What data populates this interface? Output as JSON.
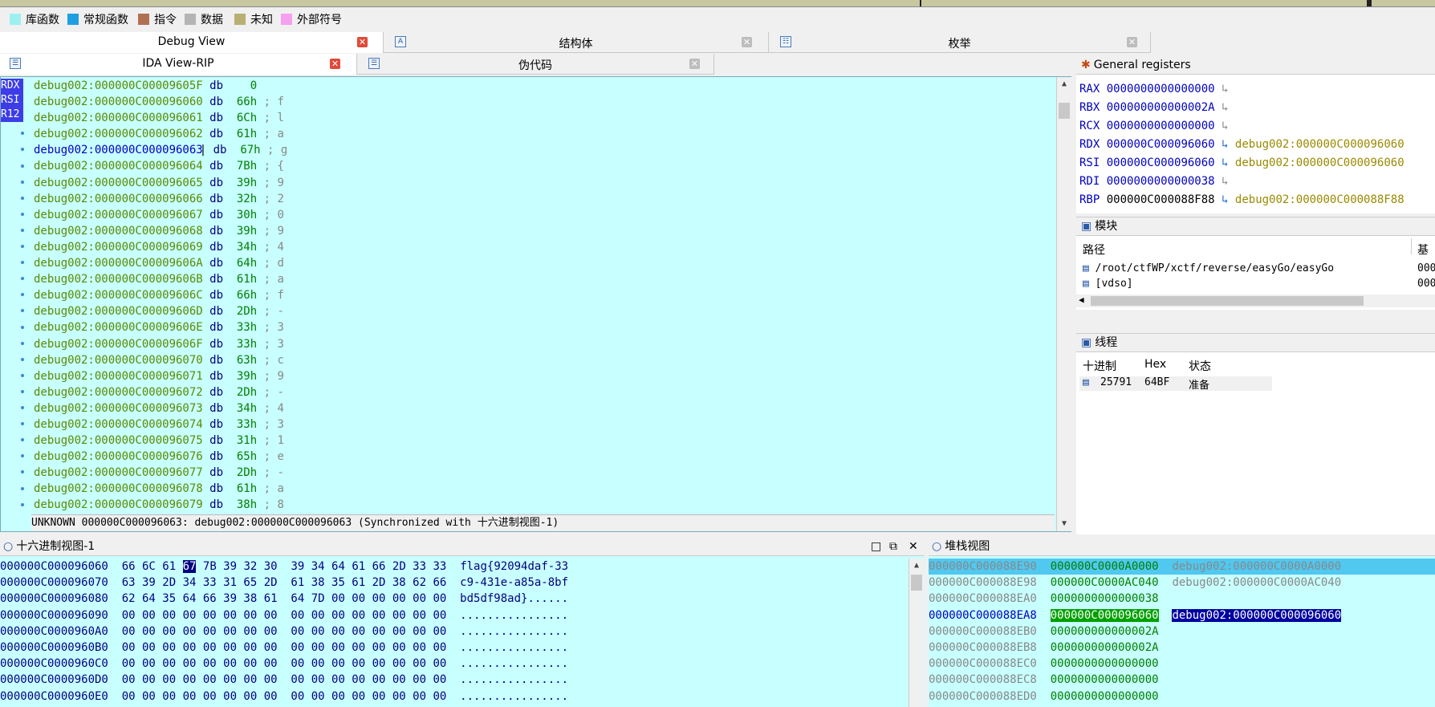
{
  "legend": [
    {
      "label": "库函数",
      "color": "#9ef0f0"
    },
    {
      "label": "常规函数",
      "color": "#1ea0e0"
    },
    {
      "label": "指令",
      "color": "#b07050"
    },
    {
      "label": "数据",
      "color": "#b4b4b4"
    },
    {
      "label": "未知",
      "color": "#b8b070"
    },
    {
      "label": "外部符号",
      "color": "#f8a0f0"
    }
  ],
  "tabs_row1": [
    {
      "label": "Debug View"
    },
    {
      "label": "结构体"
    },
    {
      "label": "枚举"
    }
  ],
  "tabs_row2": [
    {
      "label": "IDA View-RIP"
    },
    {
      "label": "伪代码"
    }
  ],
  "gutter_regs": [
    "RDX",
    "RSI",
    "R12"
  ],
  "disasm": [
    {
      "addr": "debug002:000000C00009605F",
      "op": "db",
      "val": "   0",
      "cmt": ""
    },
    {
      "addr": "debug002:000000C000096060",
      "op": "db",
      "val": " 66h",
      "cmt": "; f"
    },
    {
      "addr": "debug002:000000C000096061",
      "op": "db",
      "val": " 6Ch",
      "cmt": "; l"
    },
    {
      "addr": "debug002:000000C000096062",
      "op": "db",
      "val": " 61h",
      "cmt": "; a"
    },
    {
      "addr": "debug002:000000C000096063",
      "op": "db",
      "val": " 67h",
      "cmt": "; g"
    },
    {
      "addr": "debug002:000000C000096064",
      "op": "db",
      "val": " 7Bh",
      "cmt": "; {"
    },
    {
      "addr": "debug002:000000C000096065",
      "op": "db",
      "val": " 39h",
      "cmt": "; 9"
    },
    {
      "addr": "debug002:000000C000096066",
      "op": "db",
      "val": " 32h",
      "cmt": "; 2"
    },
    {
      "addr": "debug002:000000C000096067",
      "op": "db",
      "val": " 30h",
      "cmt": "; 0"
    },
    {
      "addr": "debug002:000000C000096068",
      "op": "db",
      "val": " 39h",
      "cmt": "; 9"
    },
    {
      "addr": "debug002:000000C000096069",
      "op": "db",
      "val": " 34h",
      "cmt": "; 4"
    },
    {
      "addr": "debug002:000000C00009606A",
      "op": "db",
      "val": " 64h",
      "cmt": "; d"
    },
    {
      "addr": "debug002:000000C00009606B",
      "op": "db",
      "val": " 61h",
      "cmt": "; a"
    },
    {
      "addr": "debug002:000000C00009606C",
      "op": "db",
      "val": " 66h",
      "cmt": "; f"
    },
    {
      "addr": "debug002:000000C00009606D",
      "op": "db",
      "val": " 2Dh",
      "cmt": "; -"
    },
    {
      "addr": "debug002:000000C00009606E",
      "op": "db",
      "val": " 33h",
      "cmt": "; 3"
    },
    {
      "addr": "debug002:000000C00009606F",
      "op": "db",
      "val": " 33h",
      "cmt": "; 3"
    },
    {
      "addr": "debug002:000000C000096070",
      "op": "db",
      "val": " 63h",
      "cmt": "; c"
    },
    {
      "addr": "debug002:000000C000096071",
      "op": "db",
      "val": " 39h",
      "cmt": "; 9"
    },
    {
      "addr": "debug002:000000C000096072",
      "op": "db",
      "val": " 2Dh",
      "cmt": "; -"
    },
    {
      "addr": "debug002:000000C000096073",
      "op": "db",
      "val": " 34h",
      "cmt": "; 4"
    },
    {
      "addr": "debug002:000000C000096074",
      "op": "db",
      "val": " 33h",
      "cmt": "; 3"
    },
    {
      "addr": "debug002:000000C000096075",
      "op": "db",
      "val": " 31h",
      "cmt": "; 1"
    },
    {
      "addr": "debug002:000000C000096076",
      "op": "db",
      "val": " 65h",
      "cmt": "; e"
    },
    {
      "addr": "debug002:000000C000096077",
      "op": "db",
      "val": " 2Dh",
      "cmt": "; -"
    },
    {
      "addr": "debug002:000000C000096078",
      "op": "db",
      "val": " 61h",
      "cmt": "; a"
    },
    {
      "addr": "debug002:000000C000096079",
      "op": "db",
      "val": " 38h",
      "cmt": "; 8"
    }
  ],
  "status": "UNKNOWN 000000C000096063: debug002:000000C000096063 (Synchronized with 十六进制视图-1)",
  "registers": {
    "title": "General registers",
    "rows": [
      {
        "name": "RAX",
        "value": "0000000000000000",
        "sym": ""
      },
      {
        "name": "RBX",
        "value": "000000000000002A",
        "sym": ""
      },
      {
        "name": "RCX",
        "value": "0000000000000000",
        "sym": ""
      },
      {
        "name": "RDX",
        "value": "000000C000096060",
        "sym": "debug002:000000C000096060"
      },
      {
        "name": "RSI",
        "value": "000000C000096060",
        "sym": "debug002:000000C000096060"
      },
      {
        "name": "RDI",
        "value": "0000000000000038",
        "sym": ""
      },
      {
        "name": "RBP",
        "value": "000000C000088F88",
        "sym": "debug002:000000C000088F88"
      }
    ]
  },
  "modules": {
    "title": "模块",
    "col_path": "路径",
    "col_base": "基",
    "rows": [
      {
        "path": "/root/ctfWP/xctf/reverse/easyGo/easyGo",
        "base": "000"
      },
      {
        "path": "[vdso]",
        "base": "000"
      }
    ]
  },
  "threads": {
    "title": "线程",
    "cols": [
      "十进制",
      "Hex",
      "状态"
    ],
    "rows": [
      {
        "dec": "25791",
        "hex": "64BF",
        "state": "准备"
      }
    ]
  },
  "hexview": {
    "title": "十六进制视图-1",
    "rows": [
      {
        "addr": "000000C000096060",
        "b1": "66 6C 61",
        "sel": "67",
        "b2": "7B 39 32 30  39 34 64 61 66 2D 33 33",
        "ascii": "flag{92094daf-33"
      },
      {
        "addr": "000000C000096070",
        "b1": "63 39 2D 34 33 31 65 2D  61 38 35 61 2D 38 62 66",
        "sel": "",
        "b2": "",
        "ascii": "c9-431e-a85a-8bf"
      },
      {
        "addr": "000000C000096080",
        "b1": "62 64 35 64 66 39 38 61  64 7D 00 00 00 00 00 00",
        "sel": "",
        "b2": "",
        "ascii": "bd5df98ad}......"
      },
      {
        "addr": "000000C000096090",
        "b1": "00 00 00 00 00 00 00 00  00 00 00 00 00 00 00 00",
        "sel": "",
        "b2": "",
        "ascii": "................"
      },
      {
        "addr": "000000C0000960A0",
        "b1": "00 00 00 00 00 00 00 00  00 00 00 00 00 00 00 00",
        "sel": "",
        "b2": "",
        "ascii": "................"
      },
      {
        "addr": "000000C0000960B0",
        "b1": "00 00 00 00 00 00 00 00  00 00 00 00 00 00 00 00",
        "sel": "",
        "b2": "",
        "ascii": "................"
      },
      {
        "addr": "000000C0000960C0",
        "b1": "00 00 00 00 00 00 00 00  00 00 00 00 00 00 00 00",
        "sel": "",
        "b2": "",
        "ascii": "................"
      },
      {
        "addr": "000000C0000960D0",
        "b1": "00 00 00 00 00 00 00 00  00 00 00 00 00 00 00 00",
        "sel": "",
        "b2": "",
        "ascii": "................"
      },
      {
        "addr": "000000C0000960E0",
        "b1": "00 00 00 00 00 00 00 00  00 00 00 00 00 00 00 00",
        "sel": "",
        "b2": "",
        "ascii": "................"
      }
    ]
  },
  "stack": {
    "title": "堆栈视图",
    "rows": [
      {
        "addr": "000000C000088E90",
        "val": "000000C0000A0000",
        "sym": "debug002:000000C0000A0000",
        "kind": "top"
      },
      {
        "addr": "000000C000088E98",
        "val": "000000C0000AC040",
        "sym": "debug002:000000C0000AC040",
        "kind": ""
      },
      {
        "addr": "000000C000088EA0",
        "val": "0000000000000038",
        "sym": "",
        "kind": ""
      },
      {
        "addr": "000000C000088EA8",
        "val": "000000C000096060",
        "sym": "debug002:000000C000096060",
        "kind": "sel"
      },
      {
        "addr": "000000C000088EB0",
        "val": "000000000000002A",
        "sym": "",
        "kind": ""
      },
      {
        "addr": "000000C000088EB8",
        "val": "000000000000002A",
        "sym": "",
        "kind": ""
      },
      {
        "addr": "000000C000088EC0",
        "val": "0000000000000000",
        "sym": "",
        "kind": ""
      },
      {
        "addr": "000000C000088EC8",
        "val": "0000000000000000",
        "sym": "",
        "kind": ""
      },
      {
        "addr": "000000C000088ED0",
        "val": "0000000000000000",
        "sym": "",
        "kind": ""
      }
    ]
  }
}
